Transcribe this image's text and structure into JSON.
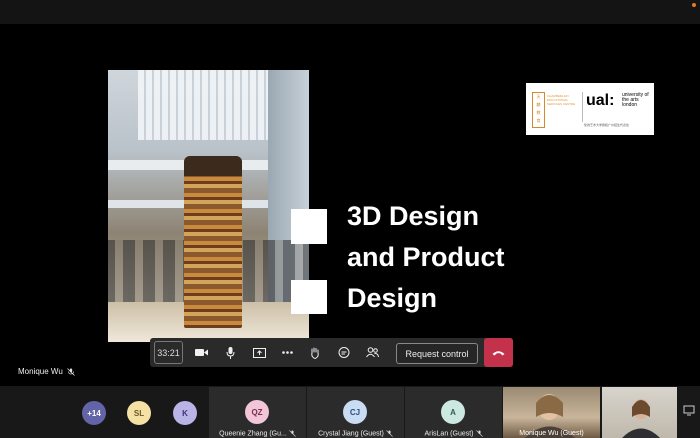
{
  "slide": {
    "title_lines": [
      "3D Design",
      "and Product",
      "Design"
    ],
    "logo": {
      "chinese_name": [
        "天",
        "麟",
        "教",
        "育"
      ],
      "partner_text": "CHAMBERLAIN EDUCATIONAL SERVICES CENTRE",
      "brand": "ual:",
      "university": "university of the arts london",
      "subtitle": "伦敦艺术大学授权广州招生代表处"
    }
  },
  "controls": {
    "timer": "33:21",
    "request_control_label": "Request control"
  },
  "presenter": {
    "name": "Monique Wu"
  },
  "participants": {
    "overflow_count": "+14",
    "avatars": [
      {
        "initials": "SL",
        "bg": "#f5e1a4",
        "fg": "#6b5a2a"
      },
      {
        "initials": "K",
        "bg": "#b9b3e6",
        "fg": "#3d3575"
      }
    ],
    "tiles": [
      {
        "initials": "QZ",
        "name": "Queenie Zhang (Gu...",
        "bg": "#f2c6d8",
        "fg": "#7a2f4e"
      },
      {
        "initials": "CJ",
        "name": "Crystal Jiang (Guest)",
        "bg": "#c9dcf3",
        "fg": "#2d4e7a"
      },
      {
        "initials": "A",
        "name": "ArisLan (Guest)",
        "bg": "#cde8e0",
        "fg": "#2b5f52"
      }
    ],
    "video_tiles": [
      {
        "name": "Monique Wu (Guest)"
      }
    ]
  },
  "colors": {
    "hangup": "#c4314b",
    "overflow_badge": "#6264a7"
  }
}
